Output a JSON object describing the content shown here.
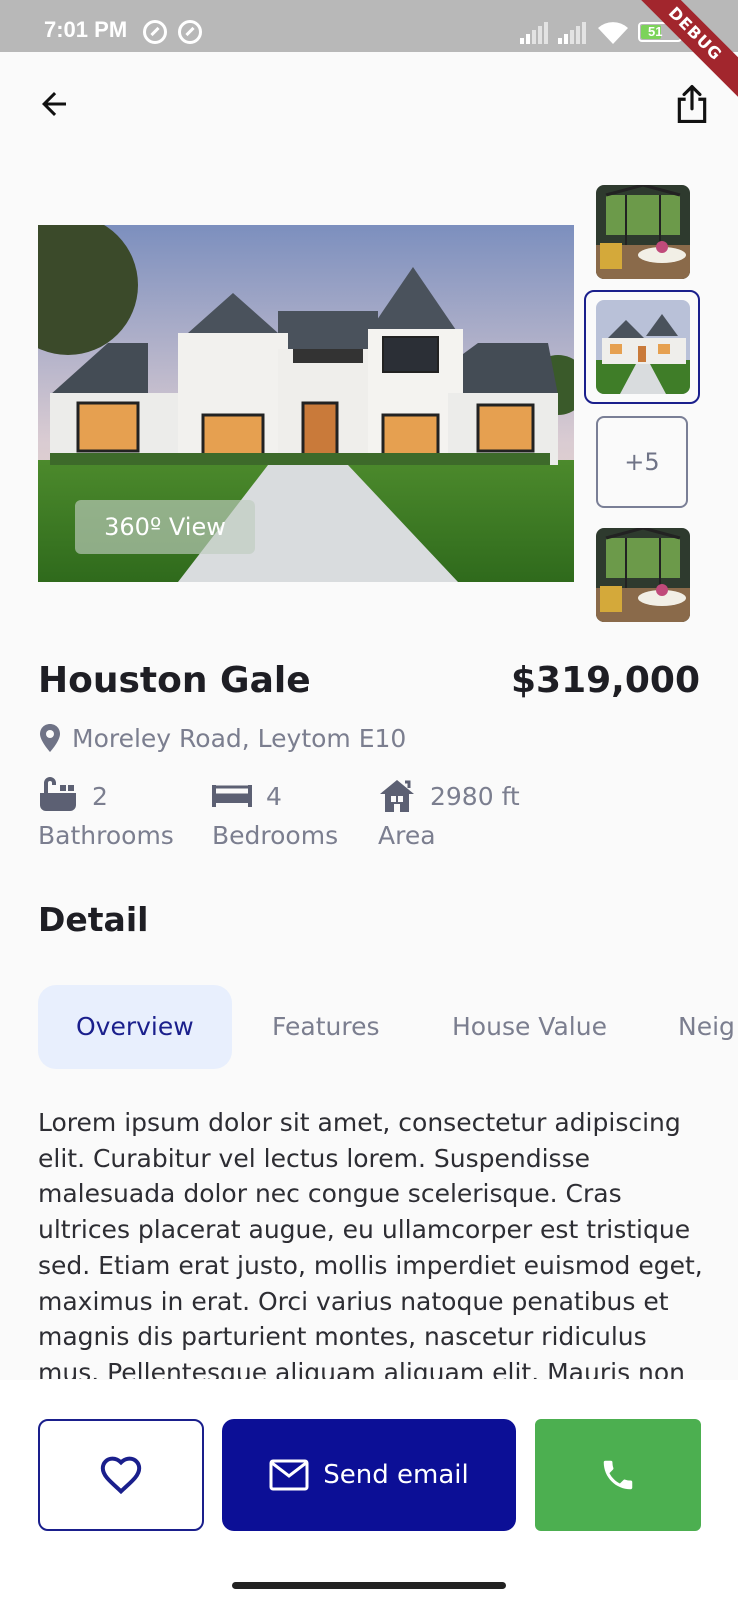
{
  "status_bar": {
    "time": "7:01 PM",
    "battery_level": "51",
    "debug_label": "DEBUG"
  },
  "header": {
    "back_icon": "arrow-left-icon",
    "share_icon": "share-icon"
  },
  "gallery": {
    "view_360_label": "360º View",
    "more_count_label": "+5",
    "thumbnails": [
      "sunroom-interior",
      "house-exterior",
      "more",
      "sunroom-interior"
    ],
    "selected_thumbnail_index": 1
  },
  "property": {
    "name": "Houston Gale",
    "price": "$319,000",
    "address": "Moreley Road, Leytom E10",
    "stats": [
      {
        "icon": "bathtub-icon",
        "value": "2",
        "label": "Bathrooms"
      },
      {
        "icon": "bed-icon",
        "value": "4",
        "label": "Bedrooms"
      },
      {
        "icon": "house-icon",
        "value": "2980 ft",
        "label": "Area"
      }
    ]
  },
  "detail": {
    "title": "Detail",
    "tabs": [
      "Overview",
      "Features",
      "House Value",
      "Neig"
    ],
    "active_tab": "Overview",
    "description": "Lorem ipsum dolor sit amet, consectetur adipiscing elit. Curabitur vel lectus lorem. Suspendisse malesuada dolor nec congue scelerisque. Cras ultrices placerat augue, eu ullamcorper est tristique sed. Etiam erat justo, mollis imperdiet euismod eget, maximus in erat. Orci varius natoque penatibus et magnis dis parturient montes, nascetur ridiculus mus. Pellentesque aliquam aliquam elit. Mauris non"
  },
  "actions": {
    "favorite_icon": "heart-icon",
    "email_icon": "mail-icon",
    "send_email_label": "Send email",
    "call_icon": "phone-icon"
  },
  "colors": {
    "primary": "#0c0f96",
    "call_green": "#4caf50",
    "active_tab_bg": "#e8effd",
    "muted_text": "#7b7e8f"
  }
}
